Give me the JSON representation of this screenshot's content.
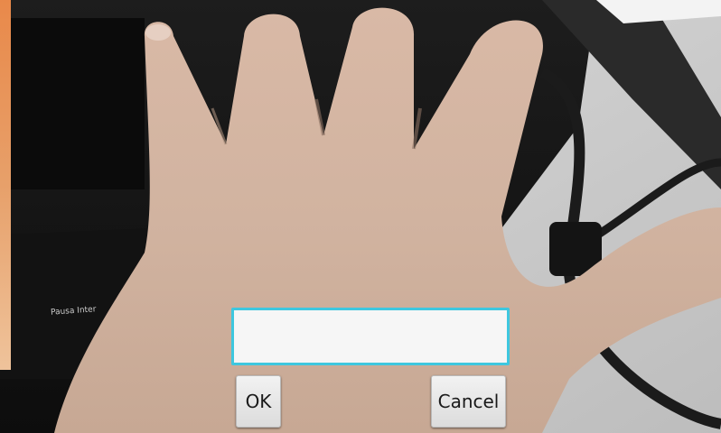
{
  "camera": {
    "scene_icon": "hand-photo-icon",
    "keyboard_key_label": "Pausa Inter"
  },
  "dialog": {
    "input_value": "",
    "input_placeholder": "",
    "ok_label": "OK",
    "cancel_label": "Cancel"
  },
  "colors": {
    "input_border": "#3ec7df",
    "input_background": "#f6f6f6",
    "button_face": "#e6e6e6",
    "orange_edge": "#e9894a"
  }
}
